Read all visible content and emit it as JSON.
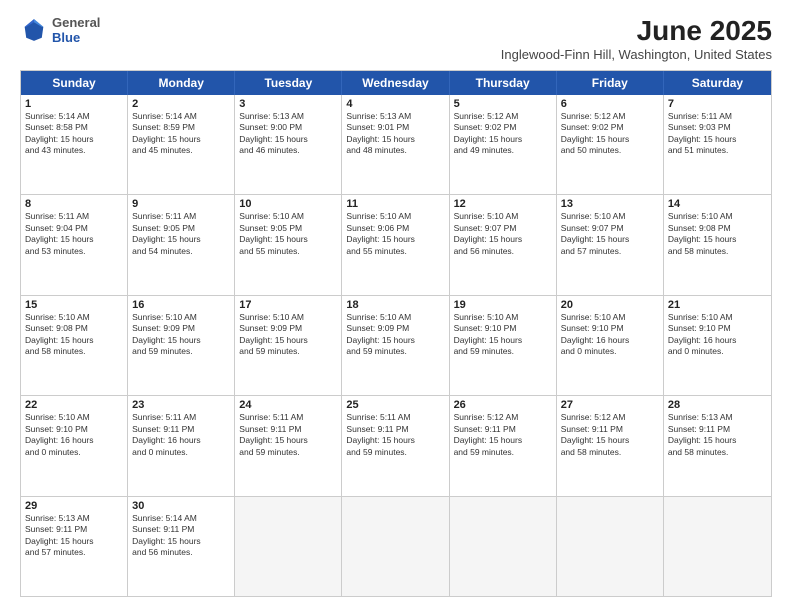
{
  "header": {
    "logo_general": "General",
    "logo_blue": "Blue",
    "title": "June 2025",
    "location": "Inglewood-Finn Hill, Washington, United States"
  },
  "days_of_week": [
    "Sunday",
    "Monday",
    "Tuesday",
    "Wednesday",
    "Thursday",
    "Friday",
    "Saturday"
  ],
  "weeks": [
    [
      {
        "day": "1",
        "text": "Sunrise: 5:14 AM\nSunset: 8:58 PM\nDaylight: 15 hours\nand 43 minutes."
      },
      {
        "day": "2",
        "text": "Sunrise: 5:14 AM\nSunset: 8:59 PM\nDaylight: 15 hours\nand 45 minutes."
      },
      {
        "day": "3",
        "text": "Sunrise: 5:13 AM\nSunset: 9:00 PM\nDaylight: 15 hours\nand 46 minutes."
      },
      {
        "day": "4",
        "text": "Sunrise: 5:13 AM\nSunset: 9:01 PM\nDaylight: 15 hours\nand 48 minutes."
      },
      {
        "day": "5",
        "text": "Sunrise: 5:12 AM\nSunset: 9:02 PM\nDaylight: 15 hours\nand 49 minutes."
      },
      {
        "day": "6",
        "text": "Sunrise: 5:12 AM\nSunset: 9:02 PM\nDaylight: 15 hours\nand 50 minutes."
      },
      {
        "day": "7",
        "text": "Sunrise: 5:11 AM\nSunset: 9:03 PM\nDaylight: 15 hours\nand 51 minutes."
      }
    ],
    [
      {
        "day": "8",
        "text": "Sunrise: 5:11 AM\nSunset: 9:04 PM\nDaylight: 15 hours\nand 53 minutes."
      },
      {
        "day": "9",
        "text": "Sunrise: 5:11 AM\nSunset: 9:05 PM\nDaylight: 15 hours\nand 54 minutes."
      },
      {
        "day": "10",
        "text": "Sunrise: 5:10 AM\nSunset: 9:05 PM\nDaylight: 15 hours\nand 55 minutes."
      },
      {
        "day": "11",
        "text": "Sunrise: 5:10 AM\nSunset: 9:06 PM\nDaylight: 15 hours\nand 55 minutes."
      },
      {
        "day": "12",
        "text": "Sunrise: 5:10 AM\nSunset: 9:07 PM\nDaylight: 15 hours\nand 56 minutes."
      },
      {
        "day": "13",
        "text": "Sunrise: 5:10 AM\nSunset: 9:07 PM\nDaylight: 15 hours\nand 57 minutes."
      },
      {
        "day": "14",
        "text": "Sunrise: 5:10 AM\nSunset: 9:08 PM\nDaylight: 15 hours\nand 58 minutes."
      }
    ],
    [
      {
        "day": "15",
        "text": "Sunrise: 5:10 AM\nSunset: 9:08 PM\nDaylight: 15 hours\nand 58 minutes."
      },
      {
        "day": "16",
        "text": "Sunrise: 5:10 AM\nSunset: 9:09 PM\nDaylight: 15 hours\nand 59 minutes."
      },
      {
        "day": "17",
        "text": "Sunrise: 5:10 AM\nSunset: 9:09 PM\nDaylight: 15 hours\nand 59 minutes."
      },
      {
        "day": "18",
        "text": "Sunrise: 5:10 AM\nSunset: 9:09 PM\nDaylight: 15 hours\nand 59 minutes."
      },
      {
        "day": "19",
        "text": "Sunrise: 5:10 AM\nSunset: 9:10 PM\nDaylight: 15 hours\nand 59 minutes."
      },
      {
        "day": "20",
        "text": "Sunrise: 5:10 AM\nSunset: 9:10 PM\nDaylight: 16 hours\nand 0 minutes."
      },
      {
        "day": "21",
        "text": "Sunrise: 5:10 AM\nSunset: 9:10 PM\nDaylight: 16 hours\nand 0 minutes."
      }
    ],
    [
      {
        "day": "22",
        "text": "Sunrise: 5:10 AM\nSunset: 9:10 PM\nDaylight: 16 hours\nand 0 minutes."
      },
      {
        "day": "23",
        "text": "Sunrise: 5:11 AM\nSunset: 9:11 PM\nDaylight: 16 hours\nand 0 minutes."
      },
      {
        "day": "24",
        "text": "Sunrise: 5:11 AM\nSunset: 9:11 PM\nDaylight: 15 hours\nand 59 minutes."
      },
      {
        "day": "25",
        "text": "Sunrise: 5:11 AM\nSunset: 9:11 PM\nDaylight: 15 hours\nand 59 minutes."
      },
      {
        "day": "26",
        "text": "Sunrise: 5:12 AM\nSunset: 9:11 PM\nDaylight: 15 hours\nand 59 minutes."
      },
      {
        "day": "27",
        "text": "Sunrise: 5:12 AM\nSunset: 9:11 PM\nDaylight: 15 hours\nand 58 minutes."
      },
      {
        "day": "28",
        "text": "Sunrise: 5:13 AM\nSunset: 9:11 PM\nDaylight: 15 hours\nand 58 minutes."
      }
    ],
    [
      {
        "day": "29",
        "text": "Sunrise: 5:13 AM\nSunset: 9:11 PM\nDaylight: 15 hours\nand 57 minutes."
      },
      {
        "day": "30",
        "text": "Sunrise: 5:14 AM\nSunset: 9:11 PM\nDaylight: 15 hours\nand 56 minutes."
      },
      {
        "day": "",
        "text": ""
      },
      {
        "day": "",
        "text": ""
      },
      {
        "day": "",
        "text": ""
      },
      {
        "day": "",
        "text": ""
      },
      {
        "day": "",
        "text": ""
      }
    ]
  ]
}
